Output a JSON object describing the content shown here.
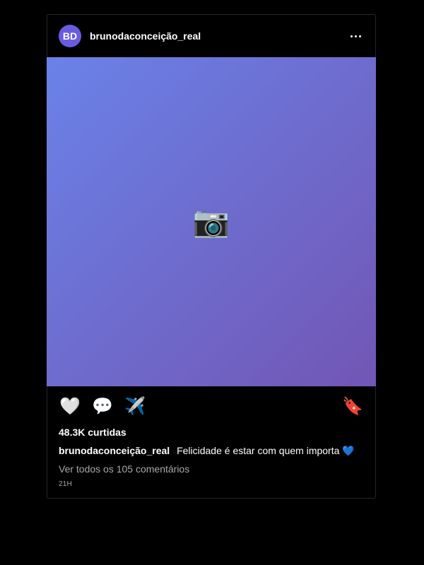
{
  "post": {
    "avatar_initials": "BD",
    "avatar_color": "#6a5ce0",
    "username": "brunodaconceição_real",
    "media": {
      "icon": "📷",
      "icon_name": "camera-icon",
      "gradient_start": "#6a82e8",
      "gradient_end": "#7256b4"
    },
    "actions": {
      "like_icon": "🤍",
      "comment_icon": "💬",
      "share_icon": "✈️",
      "save_icon": "🔖"
    },
    "likes_text": "48.3K curtidas",
    "caption_text": "Felicidade é estar com quem importa 💙",
    "view_comments_text": "Ver todos os 105 comentários",
    "timestamp": "21H"
  }
}
